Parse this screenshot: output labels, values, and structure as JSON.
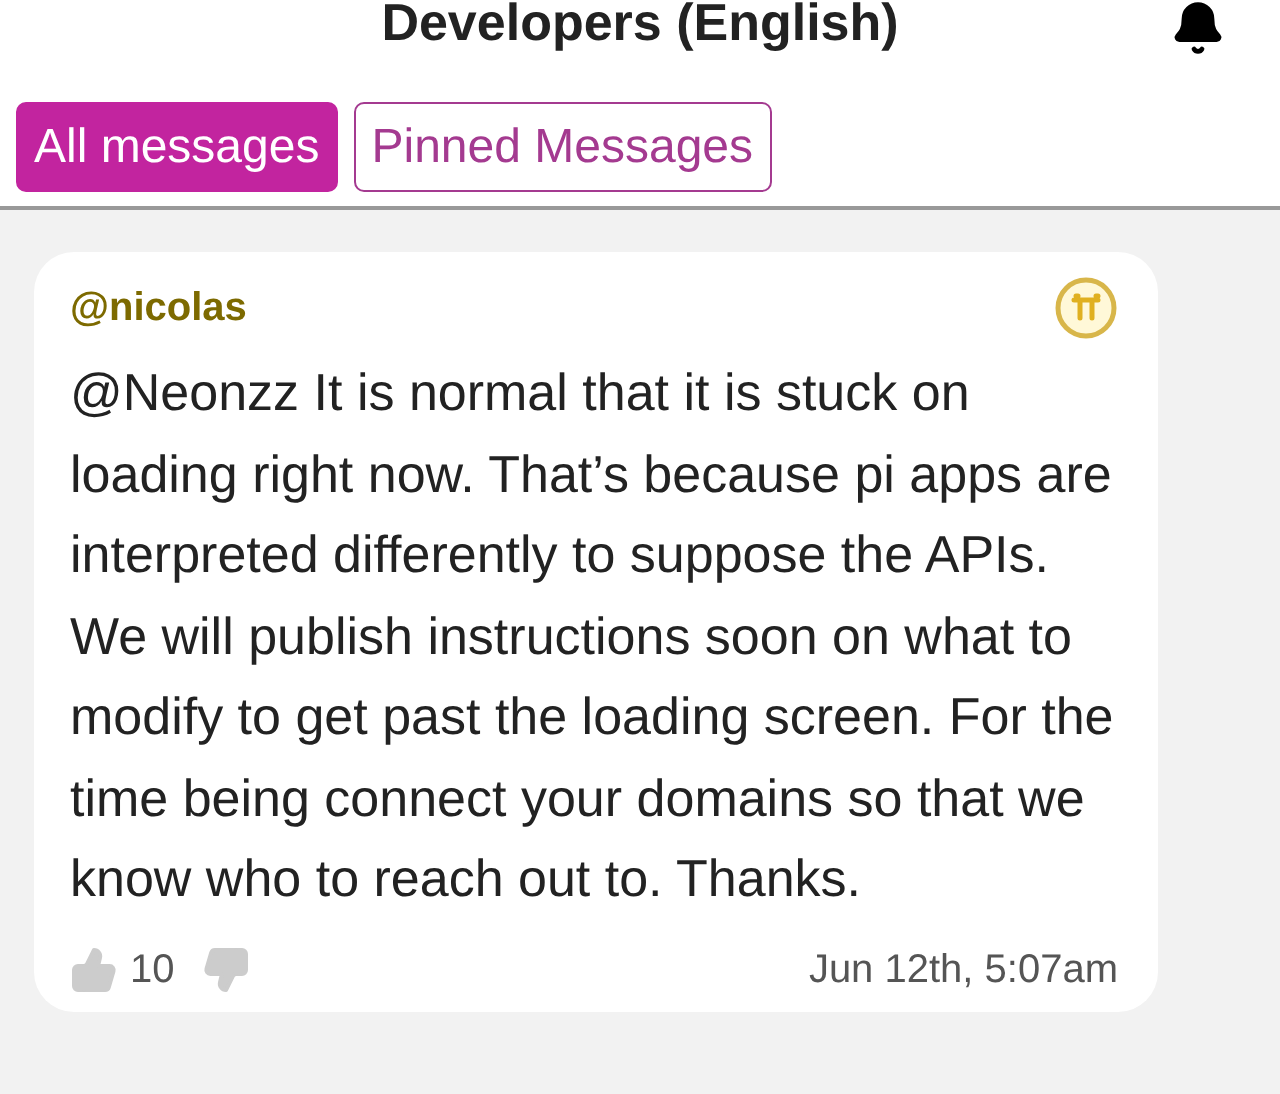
{
  "header": {
    "title": "Developers (English)"
  },
  "tabs": [
    {
      "label": "All messages",
      "selected": true
    },
    {
      "label": "Pinned Messages",
      "selected": false
    }
  ],
  "message": {
    "author": "@nicolas",
    "text": "@Neonzz It is normal that it is stuck on loading right now. That’s because pi apps are interpreted differently to suppose the APIs. We will publish instructions soon on what to modify to get past the loading screen. For the time being connect your domains so that we know who to reach out to. Thanks.",
    "likes": "10",
    "time": "Jun 12th, 5:07am"
  }
}
